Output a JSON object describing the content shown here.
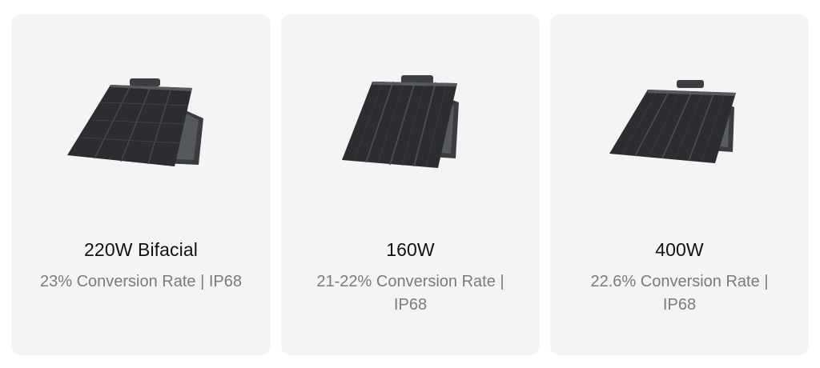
{
  "products": [
    {
      "title": "220W Bifacial",
      "subtitle": "23% Conversion Rate | IP68",
      "image_icon": "solar-panel-icon"
    },
    {
      "title": "160W",
      "subtitle": "21-22% Conversion Rate | IP68",
      "image_icon": "solar-panel-icon"
    },
    {
      "title": "400W",
      "subtitle": "22.6% Conversion Rate | IP68",
      "image_icon": "solar-panel-icon"
    }
  ],
  "colors": {
    "card_background": "#f4f4f4",
    "title_text": "#111111",
    "subtitle_text": "#7a7a7a",
    "panel_dark": "#2b2d30",
    "panel_grid": "#4a4d52"
  }
}
